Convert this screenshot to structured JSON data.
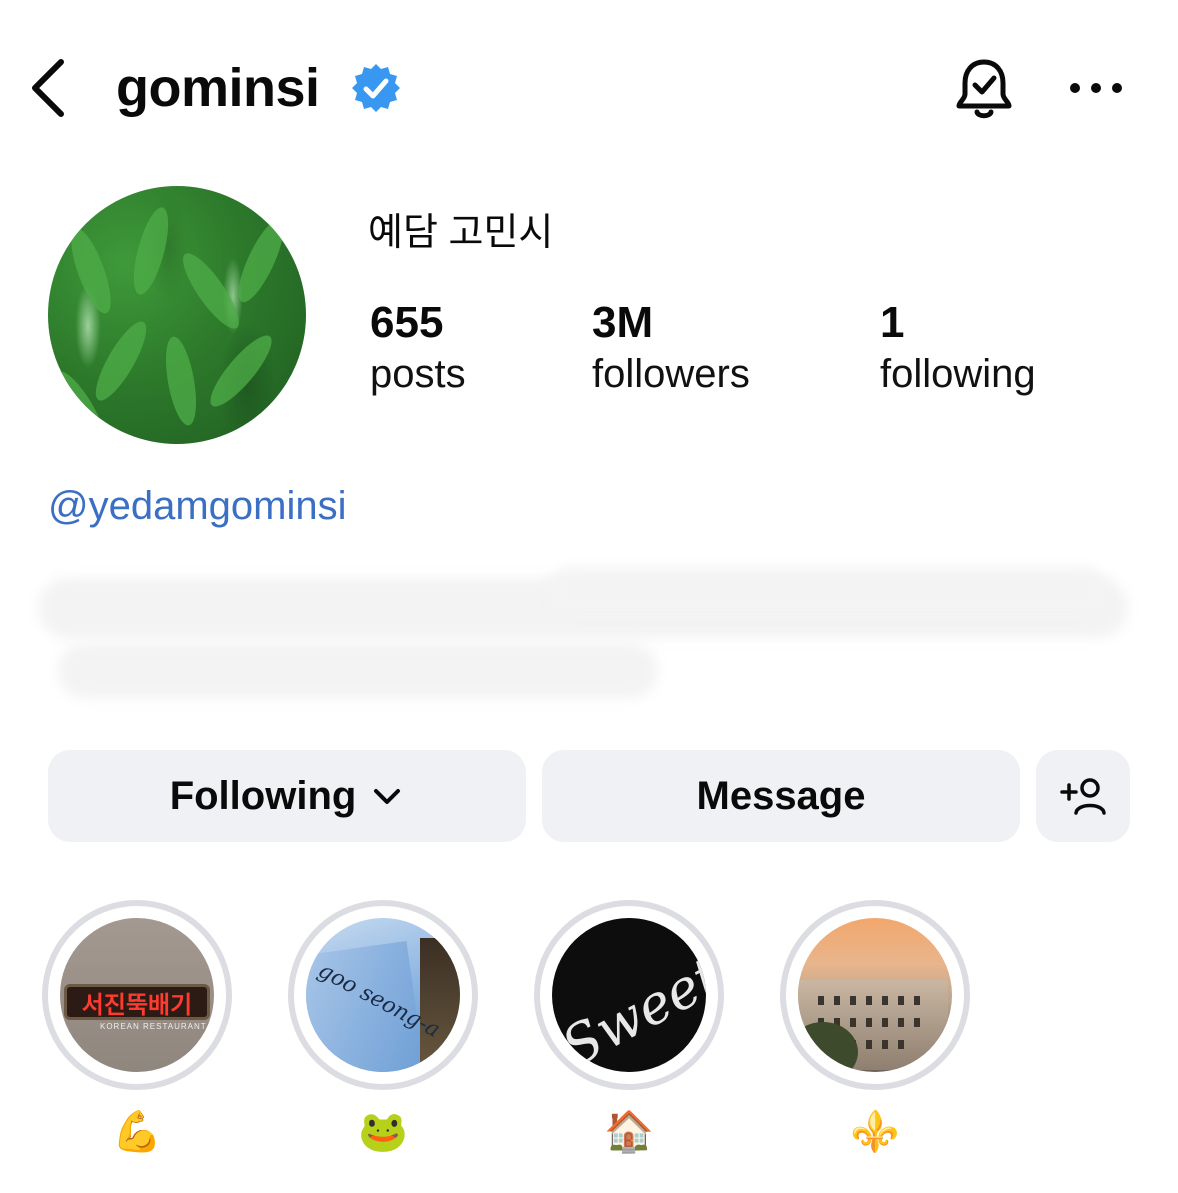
{
  "header": {
    "username": "gominsi",
    "verified": true
  },
  "profile": {
    "display_name": "예담 고민시",
    "stats": [
      {
        "value": "655",
        "label": "posts"
      },
      {
        "value": "3M",
        "label": "followers"
      },
      {
        "value": "1",
        "label": "following"
      }
    ],
    "linked_handle": "@yedamgominsi"
  },
  "actions": {
    "following_label": "Following",
    "message_label": "Message"
  },
  "highlights": [
    {
      "label": "💪",
      "cover_text": "서진뚝배기",
      "cover_subtext": "KOREAN RESTAURANT"
    },
    {
      "label": "🐸",
      "cover_text": "goo seong-a"
    },
    {
      "label": "🏠",
      "cover_text": "Sweet Home"
    },
    {
      "label": "⚜️"
    }
  ],
  "colors": {
    "link": "#3b6fc4",
    "verified_badge": "#3897f0",
    "button_bg": "#eff1f4",
    "highlight_ring": "#dcdde2"
  },
  "icons": [
    "back-arrow-icon",
    "verified-badge-icon",
    "bell-check-icon",
    "more-dots-icon",
    "chevron-down-icon",
    "add-user-icon"
  ]
}
